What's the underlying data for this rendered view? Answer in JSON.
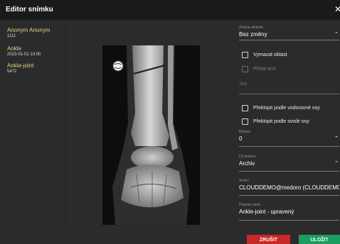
{
  "dialog": {
    "title": "Editor snímku"
  },
  "patient": {
    "name": "Anonym Anonym",
    "id": "1111"
  },
  "study": {
    "description": "Ankle",
    "datetime": "2023-01-01 10:00"
  },
  "series": {
    "description": "Ankle-joint",
    "number": "5472"
  },
  "form": {
    "attribute_change": {
      "label": "Změna atributů",
      "value": "Bez změny"
    },
    "clear_area": {
      "label": "Vymazat oblast",
      "checked": false
    },
    "add_text": {
      "label": "Přidat text",
      "checked": false,
      "disabled": true
    },
    "text_placeholder": "Text",
    "flip_horizontal": {
      "label": "Překlopit podle vodorovné osy",
      "checked": false
    },
    "flip_vertical": {
      "label": "Překlopit podle svislé osy",
      "checked": false
    },
    "rotation": {
      "label": "Rotace",
      "value": "0"
    },
    "save_target": {
      "label": "Cíl uložení",
      "value": "Archiv"
    },
    "archive": {
      "label": "Archiv",
      "value": "CLOUDDEMO@medoro (CLOUDDEMO@"
    },
    "series_description": {
      "label": "Popisek série",
      "value": "Ankle-joint - upravený"
    }
  },
  "buttons": {
    "cancel": "ZRUŠIT",
    "save": "ULOŽIT"
  },
  "colors": {
    "accent_text": "#e3d18b",
    "cancel": "#c62828",
    "save": "#1a9d5f",
    "titlebar": "#1a1a1a"
  }
}
